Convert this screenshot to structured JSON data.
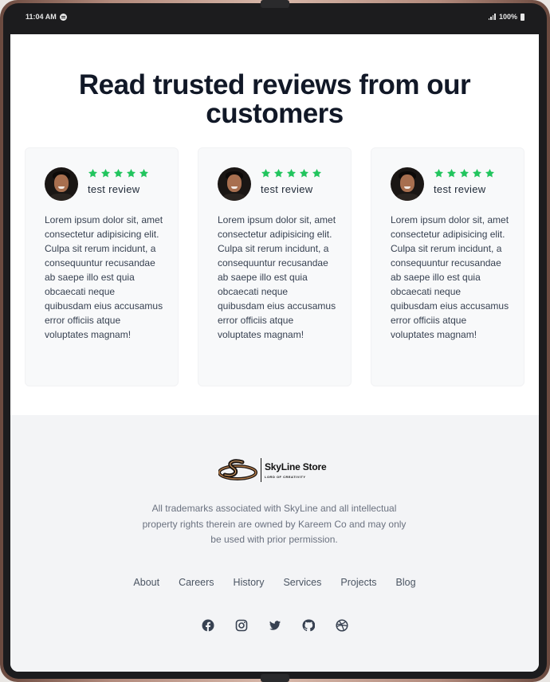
{
  "status_bar": {
    "time": "11:04 AM",
    "battery": "100%"
  },
  "heading": "Read trusted reviews from our customers",
  "reviews": [
    {
      "rating": 5,
      "title": "test review",
      "text": "Lorem ipsum dolor sit, amet consectetur adipisicing elit. Culpa sit rerum incidunt, a consequuntur recusandae ab saepe illo est quia obcaecati neque quibusdam eius accusamus error officiis atque voluptates magnam!"
    },
    {
      "rating": 5,
      "title": "test review",
      "text": "Lorem ipsum dolor sit, amet consectetur adipisicing elit. Culpa sit rerum incidunt, a consequuntur recusandae ab saepe illo est quia obcaecati neque quibusdam eius accusamus error officiis atque voluptates magnam!"
    },
    {
      "rating": 5,
      "title": "test review",
      "text": "Lorem ipsum dolor sit, amet consectetur adipisicing elit. Culpa sit rerum incidunt, a consequuntur recusandae ab saepe illo est quia obcaecati neque quibusdam eius accusamus error officiis atque voluptates magnam!"
    }
  ],
  "footer": {
    "brand_name": "SkyLine Store",
    "brand_tagline": "LORD OF CREATIVITY",
    "note": "All trademarks associated with SkyLine and all intellectual property rights therein are owned by Kareem Co and may only be used with prior permission.",
    "nav": [
      "About",
      "Careers",
      "History",
      "Services",
      "Projects",
      "Blog"
    ],
    "social_icons": [
      "facebook-icon",
      "instagram-icon",
      "twitter-icon",
      "github-icon",
      "dribbble-icon"
    ]
  },
  "colors": {
    "star": "#22c55e",
    "heading": "#111827",
    "card_bg": "#f8f9fa",
    "footer_bg": "#f3f4f6"
  }
}
